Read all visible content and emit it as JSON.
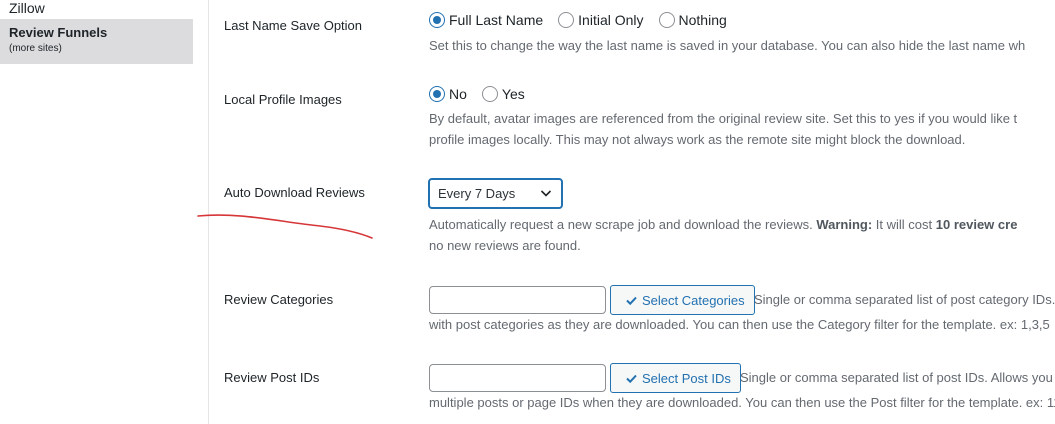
{
  "sidebar": {
    "items": [
      {
        "label": "Zillow"
      },
      {
        "label": "Review Funnels",
        "sub": "(more sites)"
      }
    ]
  },
  "settings": {
    "last_name": {
      "label": "Last Name Save Option",
      "options": [
        "Full Last Name",
        "Initial Only",
        "Nothing"
      ],
      "selected": "Full Last Name",
      "description": "Set this to change the way the last name is saved in your database. You can also hide the last name wh"
    },
    "local_images": {
      "label": "Local Profile Images",
      "options": [
        "No",
        "Yes"
      ],
      "selected": "No",
      "description_line1": "By default, avatar images are referenced from the original review site. Set this to yes if you would like t",
      "description_line2": "profile images locally. This may not always work as the remote site might block the download."
    },
    "auto_download": {
      "label": "Auto Download Reviews",
      "selected_value": "Every 7 Days",
      "desc_part1": "Automatically request a new scrape job and download the reviews. ",
      "desc_warning": "Warning:",
      "desc_part2": " It will cost ",
      "desc_bold2": "10 review cre",
      "description_line2": "no new reviews are found."
    },
    "categories": {
      "label": "Review Categories",
      "input_value": "",
      "button_label": "Select Categories",
      "inline_desc": "Single or comma separated list of post category IDs.",
      "description_line2": "with post categories as they are downloaded. You can then use the Category filter for the template. ex: 1,3,5"
    },
    "post_ids": {
      "label": "Review Post IDs",
      "input_value": "",
      "button_label": "Select Post IDs",
      "inline_desc": "Single or comma separated list of post IDs. Allows you t",
      "description_line2": "multiple posts or page IDs when they are downloaded. You can then use the Post filter for the template. ex: 11"
    }
  },
  "colors": {
    "accent": "#2271b1",
    "sidebar_active": "#dcdcde",
    "annotation": "#d63638"
  },
  "icons": [
    "chevron-down-icon",
    "checkmark-icon"
  ]
}
